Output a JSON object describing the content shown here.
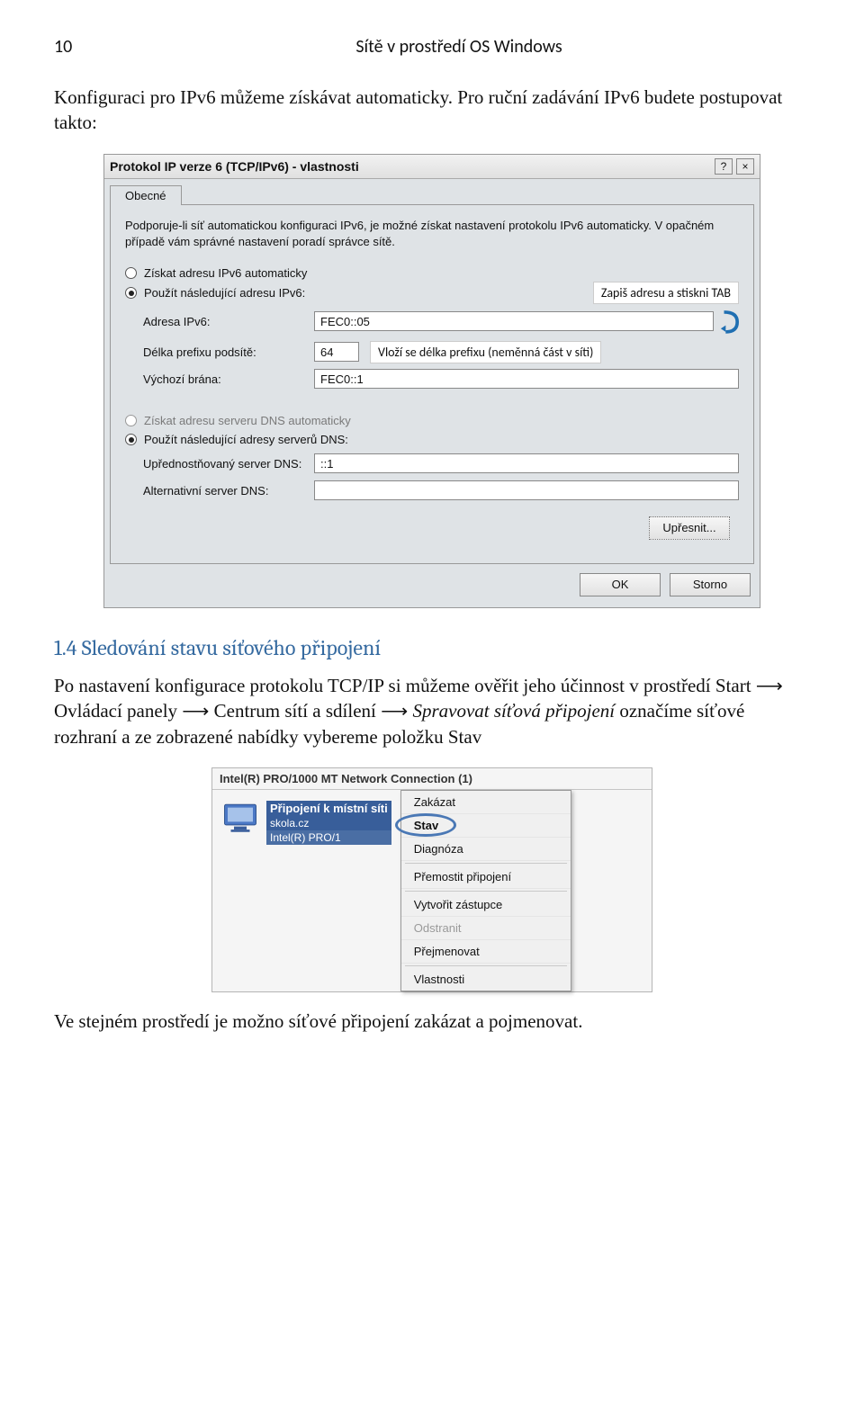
{
  "header": {
    "page_number": "10",
    "title": "Sítě v prostředí OS Windows"
  },
  "para1": "Konfiguraci pro IPv6 můžeme získávat automaticky. Pro ruční zadávání IPv6 budete postupovat takto:",
  "dialog": {
    "title": "Protokol IP verze 6 (TCP/IPv6) - vlastnosti",
    "help_btn": "?",
    "close_btn": "×",
    "tab": "Obecné",
    "intro": "Podporuje-li síť automatickou konfiguraci IPv6, je možné získat nastavení protokolu IPv6 automaticky. V opačném případě vám správné nastavení poradí správce sítě.",
    "radio_auto_addr": "Získat adresu IPv6 automaticky",
    "radio_manual_addr": "Použít následující adresu IPv6:",
    "label_addr": "Adresa IPv6:",
    "value_addr": "FEC0::05",
    "note_addr": "Zapiš adresu a stiskni TAB",
    "label_prefix": "Délka prefixu podsítě:",
    "value_prefix": "64",
    "note_prefix": "Vloží se délka prefixu (neměnná část v síti)",
    "label_gw": "Výchozí brána:",
    "value_gw": "FEC0::1",
    "radio_auto_dns": "Získat adresu serveru DNS automaticky",
    "radio_manual_dns": "Použít následující adresy serverů DNS:",
    "label_dns1": "Upřednostňovaný server DNS:",
    "value_dns1": "::1",
    "label_dns2": "Alternativní server DNS:",
    "value_dns2": "",
    "btn_adv": "Upřesnit...",
    "btn_ok": "OK",
    "btn_cancel": "Storno"
  },
  "section_title": "1.4 Sledování stavu síťového připojení",
  "para2_a": "Po nastavení konfigurace protokolu TCP/IP si můžeme ověřit jeho účinnost v prostředí Start ",
  "para2_b": " Ovládací panely ",
  "para2_c": " Centrum sítí a sdílení ",
  "para2_d_it": "Spravovat síťová připojení",
  "para2_e": "  označíme  síťové rozhraní a ze zobrazené nabídky vybereme položku Stav",
  "arrow": "⟶",
  "nc": {
    "adapter_title": "Intel(R) PRO/1000 MT Network Connection (1)",
    "line1": "Připojení k místní síti",
    "line2": "skola.cz",
    "line3": "Intel(R) PRO/1"
  },
  "menu": {
    "zakazat": "Zakázat",
    "stav": "Stav",
    "diagnoza": "Diagnóza",
    "premostit": "Přemostit připojení",
    "zastupce": "Vytvořit zástupce",
    "odstranit": "Odstranit",
    "prejmenovat": "Přejmenovat",
    "vlastnosti": "Vlastnosti"
  },
  "para3": "Ve stejném prostředí je možno síťové připojení zakázat a pojmenovat."
}
